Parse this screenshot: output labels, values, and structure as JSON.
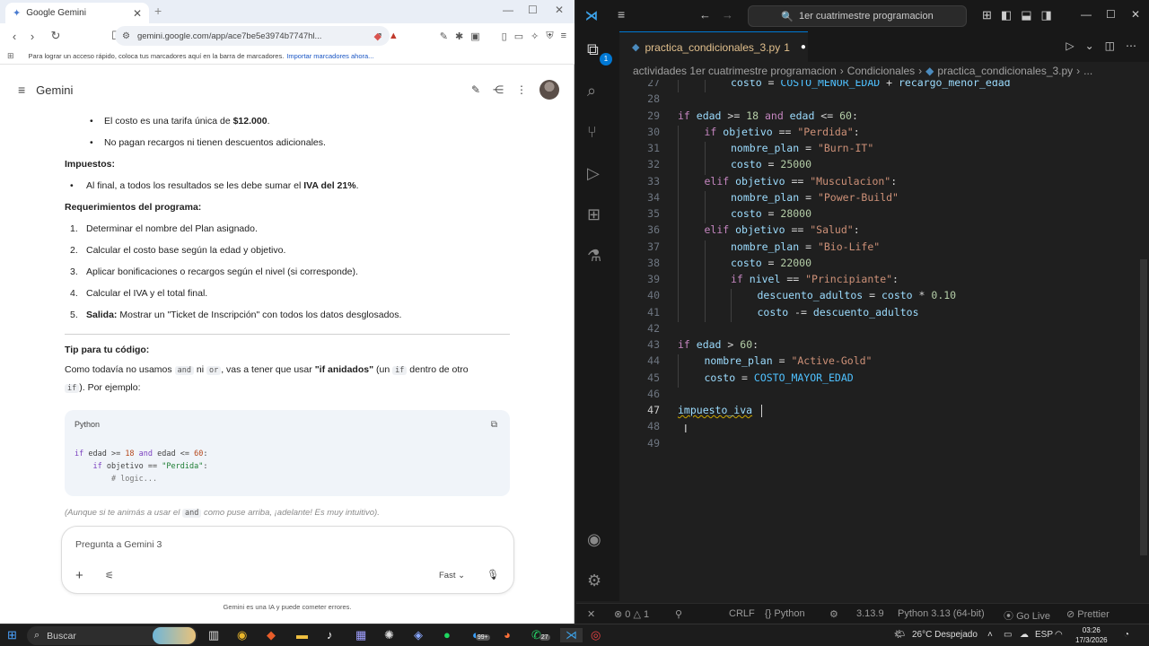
{
  "browser": {
    "tab_title": "Google Gemini",
    "url": "gemini.google.com/app/ace7be5e3974b7747hl...",
    "bookmarks_text": "Para lograr un acceso rápido, coloca tus marcadores aquí en la barra de marcadores.",
    "bookmarks_link": "Importar marcadores ahora..."
  },
  "gemini": {
    "brand": "Gemini",
    "bullets_top": [
      {
        "pre": "El costo es una tarifa única de ",
        "bold": "$12.000",
        "post": "."
      },
      {
        "pre": "No pagan recargos ni tienen descuentos adicionales.",
        "bold": "",
        "post": ""
      }
    ],
    "impuestos_heading": "Impuestos:",
    "impuestos_item": {
      "pre": "Al final, a todos los resultados se les debe sumar el ",
      "bold": "IVA del 21%",
      "post": "."
    },
    "req_heading": "Requerimientos del programa:",
    "requirements": [
      {
        "num": "1.",
        "bold": "",
        "text": "Determinar el nombre del Plan asignado."
      },
      {
        "num": "2.",
        "bold": "",
        "text": "Calcular el costo base según la edad y objetivo."
      },
      {
        "num": "3.",
        "bold": "",
        "text": "Aplicar bonificaciones o recargos según el nivel (si corresponde)."
      },
      {
        "num": "4.",
        "bold": "",
        "text": "Calcular el IVA y el total final."
      },
      {
        "num": "5.",
        "bold": "Salida:",
        "text": " Mostrar un \"Ticket de Inscripción\" con todos los datos desglosados."
      }
    ],
    "tip_heading": "Tip para tu código:",
    "tip": {
      "p1": "Como todavía no usamos ",
      "kw1": "and",
      "p2": " ni ",
      "kw2": "or",
      "p3": ", vas a tener que usar ",
      "bold": "\"if anidados\"",
      "p4": " (un ",
      "kw3": "if",
      "p5": " dentro de otro",
      "kw4": "if",
      "p6": "). Por ejemplo:"
    },
    "code_lang": "Python",
    "code_lines": [
      {
        "kw": "if",
        "rest1": " edad >= ",
        "n1": "18",
        "and": " and",
        "rest2": " edad <= ",
        "n2": "60",
        "end": ":"
      },
      {
        "indent": "    ",
        "kw": "if",
        "rest": " objetivo == ",
        "str": "\"Perdida\"",
        "end": ":"
      },
      {
        "indent": "        ",
        "comment": "# logic..."
      }
    ],
    "note": {
      "pre": "(Aunque si te animás a usar el ",
      "kw": "and",
      "post": " como puse arriba, ¡adelante! Es muy intuitivo)."
    },
    "input_placeholder": "Pregunta a Gemini 3",
    "mode": "Fast",
    "disclaimer": "Gemini es una IA y puede cometer errores."
  },
  "vscode": {
    "search": "1er cuatrimestre programacion",
    "tab_name": "practica_condicionales_3.py",
    "tab_count": "1",
    "explorer_badge": "1",
    "breadcrumbs": [
      "actividades 1er cuatrimestre programacion",
      "Condicionales",
      "practica_condicionales_3.py",
      "..."
    ],
    "code_lines": [
      {
        "n": "27",
        "html_key": "l27",
        "indent": 2
      },
      {
        "n": "28",
        "html_key": "l28",
        "indent": 0
      },
      {
        "n": "29",
        "html_key": "l29",
        "indent": 0
      },
      {
        "n": "30",
        "html_key": "l30",
        "indent": 1
      },
      {
        "n": "31",
        "html_key": "l31",
        "indent": 2
      },
      {
        "n": "32",
        "html_key": "l32",
        "indent": 2
      },
      {
        "n": "33",
        "html_key": "l33",
        "indent": 1
      },
      {
        "n": "34",
        "html_key": "l34",
        "indent": 2
      },
      {
        "n": "35",
        "html_key": "l35",
        "indent": 2
      },
      {
        "n": "36",
        "html_key": "l36",
        "indent": 1
      },
      {
        "n": "37",
        "html_key": "l37",
        "indent": 2
      },
      {
        "n": "38",
        "html_key": "l38",
        "indent": 2
      },
      {
        "n": "39",
        "html_key": "l39",
        "indent": 2
      },
      {
        "n": "40",
        "html_key": "l40",
        "indent": 3
      },
      {
        "n": "41",
        "html_key": "l41",
        "indent": 3
      },
      {
        "n": "42",
        "html_key": "l42",
        "indent": 0
      },
      {
        "n": "43",
        "html_key": "l43",
        "indent": 0
      },
      {
        "n": "44",
        "html_key": "l44",
        "indent": 1
      },
      {
        "n": "45",
        "html_key": "l45",
        "indent": 1
      },
      {
        "n": "46",
        "html_key": "l46",
        "indent": 0
      },
      {
        "n": "47",
        "html_key": "l47",
        "indent": 0
      },
      {
        "n": "48",
        "html_key": "l48",
        "indent": 0
      },
      {
        "n": "49",
        "html_key": "l49",
        "indent": 0
      }
    ],
    "current_line": "47",
    "tokens": {
      "l27": [
        [
          "t-var",
          "costo"
        ],
        [
          "t-op",
          " = "
        ],
        [
          "t-const",
          "COSTO_MENOR_EDAD"
        ],
        [
          "t-op",
          " + "
        ],
        [
          "t-var",
          "recargo_menor_edad"
        ]
      ],
      "l28": [],
      "l29": [
        [
          "t-kw",
          "if"
        ],
        [
          "t-var",
          " edad"
        ],
        [
          "t-op",
          " >= "
        ],
        [
          "t-num",
          "18"
        ],
        [
          "t-kw",
          " and"
        ],
        [
          "t-var",
          " edad"
        ],
        [
          "t-op",
          " <= "
        ],
        [
          "t-num",
          "60"
        ],
        [
          "t-op",
          ":"
        ]
      ],
      "l30": [
        [
          "t-kw",
          "if"
        ],
        [
          "t-var",
          " objetivo"
        ],
        [
          "t-op",
          " == "
        ],
        [
          "t-str",
          "\"Perdida\""
        ],
        [
          "t-op",
          ":"
        ]
      ],
      "l31": [
        [
          "t-var",
          "nombre_plan"
        ],
        [
          "t-op",
          " = "
        ],
        [
          "t-str",
          "\"Burn-IT\""
        ]
      ],
      "l32": [
        [
          "t-var",
          "costo"
        ],
        [
          "t-op",
          " = "
        ],
        [
          "t-num",
          "25000"
        ]
      ],
      "l33": [
        [
          "t-kw",
          "elif"
        ],
        [
          "t-var",
          " objetivo"
        ],
        [
          "t-op",
          " == "
        ],
        [
          "t-str",
          "\"Musculacion\""
        ],
        [
          "t-op",
          ":"
        ]
      ],
      "l34": [
        [
          "t-var",
          "nombre_plan"
        ],
        [
          "t-op",
          " = "
        ],
        [
          "t-str",
          "\"Power-Build\""
        ]
      ],
      "l35": [
        [
          "t-var",
          "costo"
        ],
        [
          "t-op",
          " = "
        ],
        [
          "t-num",
          "28000"
        ]
      ],
      "l36": [
        [
          "t-kw",
          "elif"
        ],
        [
          "t-var",
          " objetivo"
        ],
        [
          "t-op",
          " == "
        ],
        [
          "t-str",
          "\"Salud\""
        ],
        [
          "t-op",
          ":"
        ]
      ],
      "l37": [
        [
          "t-var",
          "nombre_plan"
        ],
        [
          "t-op",
          " = "
        ],
        [
          "t-str",
          "\"Bio-Life\""
        ]
      ],
      "l38": [
        [
          "t-var",
          "costo"
        ],
        [
          "t-op",
          " = "
        ],
        [
          "t-num",
          "22000"
        ]
      ],
      "l39": [
        [
          "t-kw",
          "if"
        ],
        [
          "t-var",
          " nivel"
        ],
        [
          "t-op",
          " == "
        ],
        [
          "t-str",
          "\"Principiante\""
        ],
        [
          "t-op",
          ":"
        ]
      ],
      "l40": [
        [
          "t-var",
          "descuento_adultos"
        ],
        [
          "t-op",
          " = "
        ],
        [
          "t-var",
          "costo"
        ],
        [
          "t-op",
          " * "
        ],
        [
          "t-num",
          "0.10"
        ]
      ],
      "l41": [
        [
          "t-var",
          "costo"
        ],
        [
          "t-op",
          " -= "
        ],
        [
          "t-var",
          "descuento_adultos"
        ]
      ],
      "l42": [],
      "l43": [
        [
          "t-kw",
          "if"
        ],
        [
          "t-var",
          " edad"
        ],
        [
          "t-op",
          " > "
        ],
        [
          "t-num",
          "60"
        ],
        [
          "t-op",
          ":"
        ]
      ],
      "l44": [
        [
          "t-var",
          "nombre_plan"
        ],
        [
          "t-op",
          " = "
        ],
        [
          "t-str",
          "\"Active-Gold\""
        ]
      ],
      "l45": [
        [
          "t-var",
          "costo"
        ],
        [
          "t-op",
          " = "
        ],
        [
          "t-const",
          "COSTO_MAYOR_EDAD"
        ]
      ],
      "l46": [],
      "l47": [
        [
          "t-var squig",
          "impuesto_iva"
        ],
        [
          "t-op",
          " "
        ]
      ],
      "l48": [],
      "l49": []
    },
    "status": {
      "errors": "0",
      "warnings": "1",
      "eol": "CRLF",
      "language": "Python",
      "version": "3.13.9",
      "interpreter": "Python 3.13 (64-bit)",
      "golive": "Go Live",
      "prettier": "Prettier"
    }
  },
  "taskbar": {
    "search_placeholder": "Buscar",
    "weather": "26°C  Despejado",
    "lang": "ESP",
    "time": "03:26",
    "date": "17/3/2026",
    "mail_badge": "99+",
    "whatsapp_badge": "27"
  }
}
